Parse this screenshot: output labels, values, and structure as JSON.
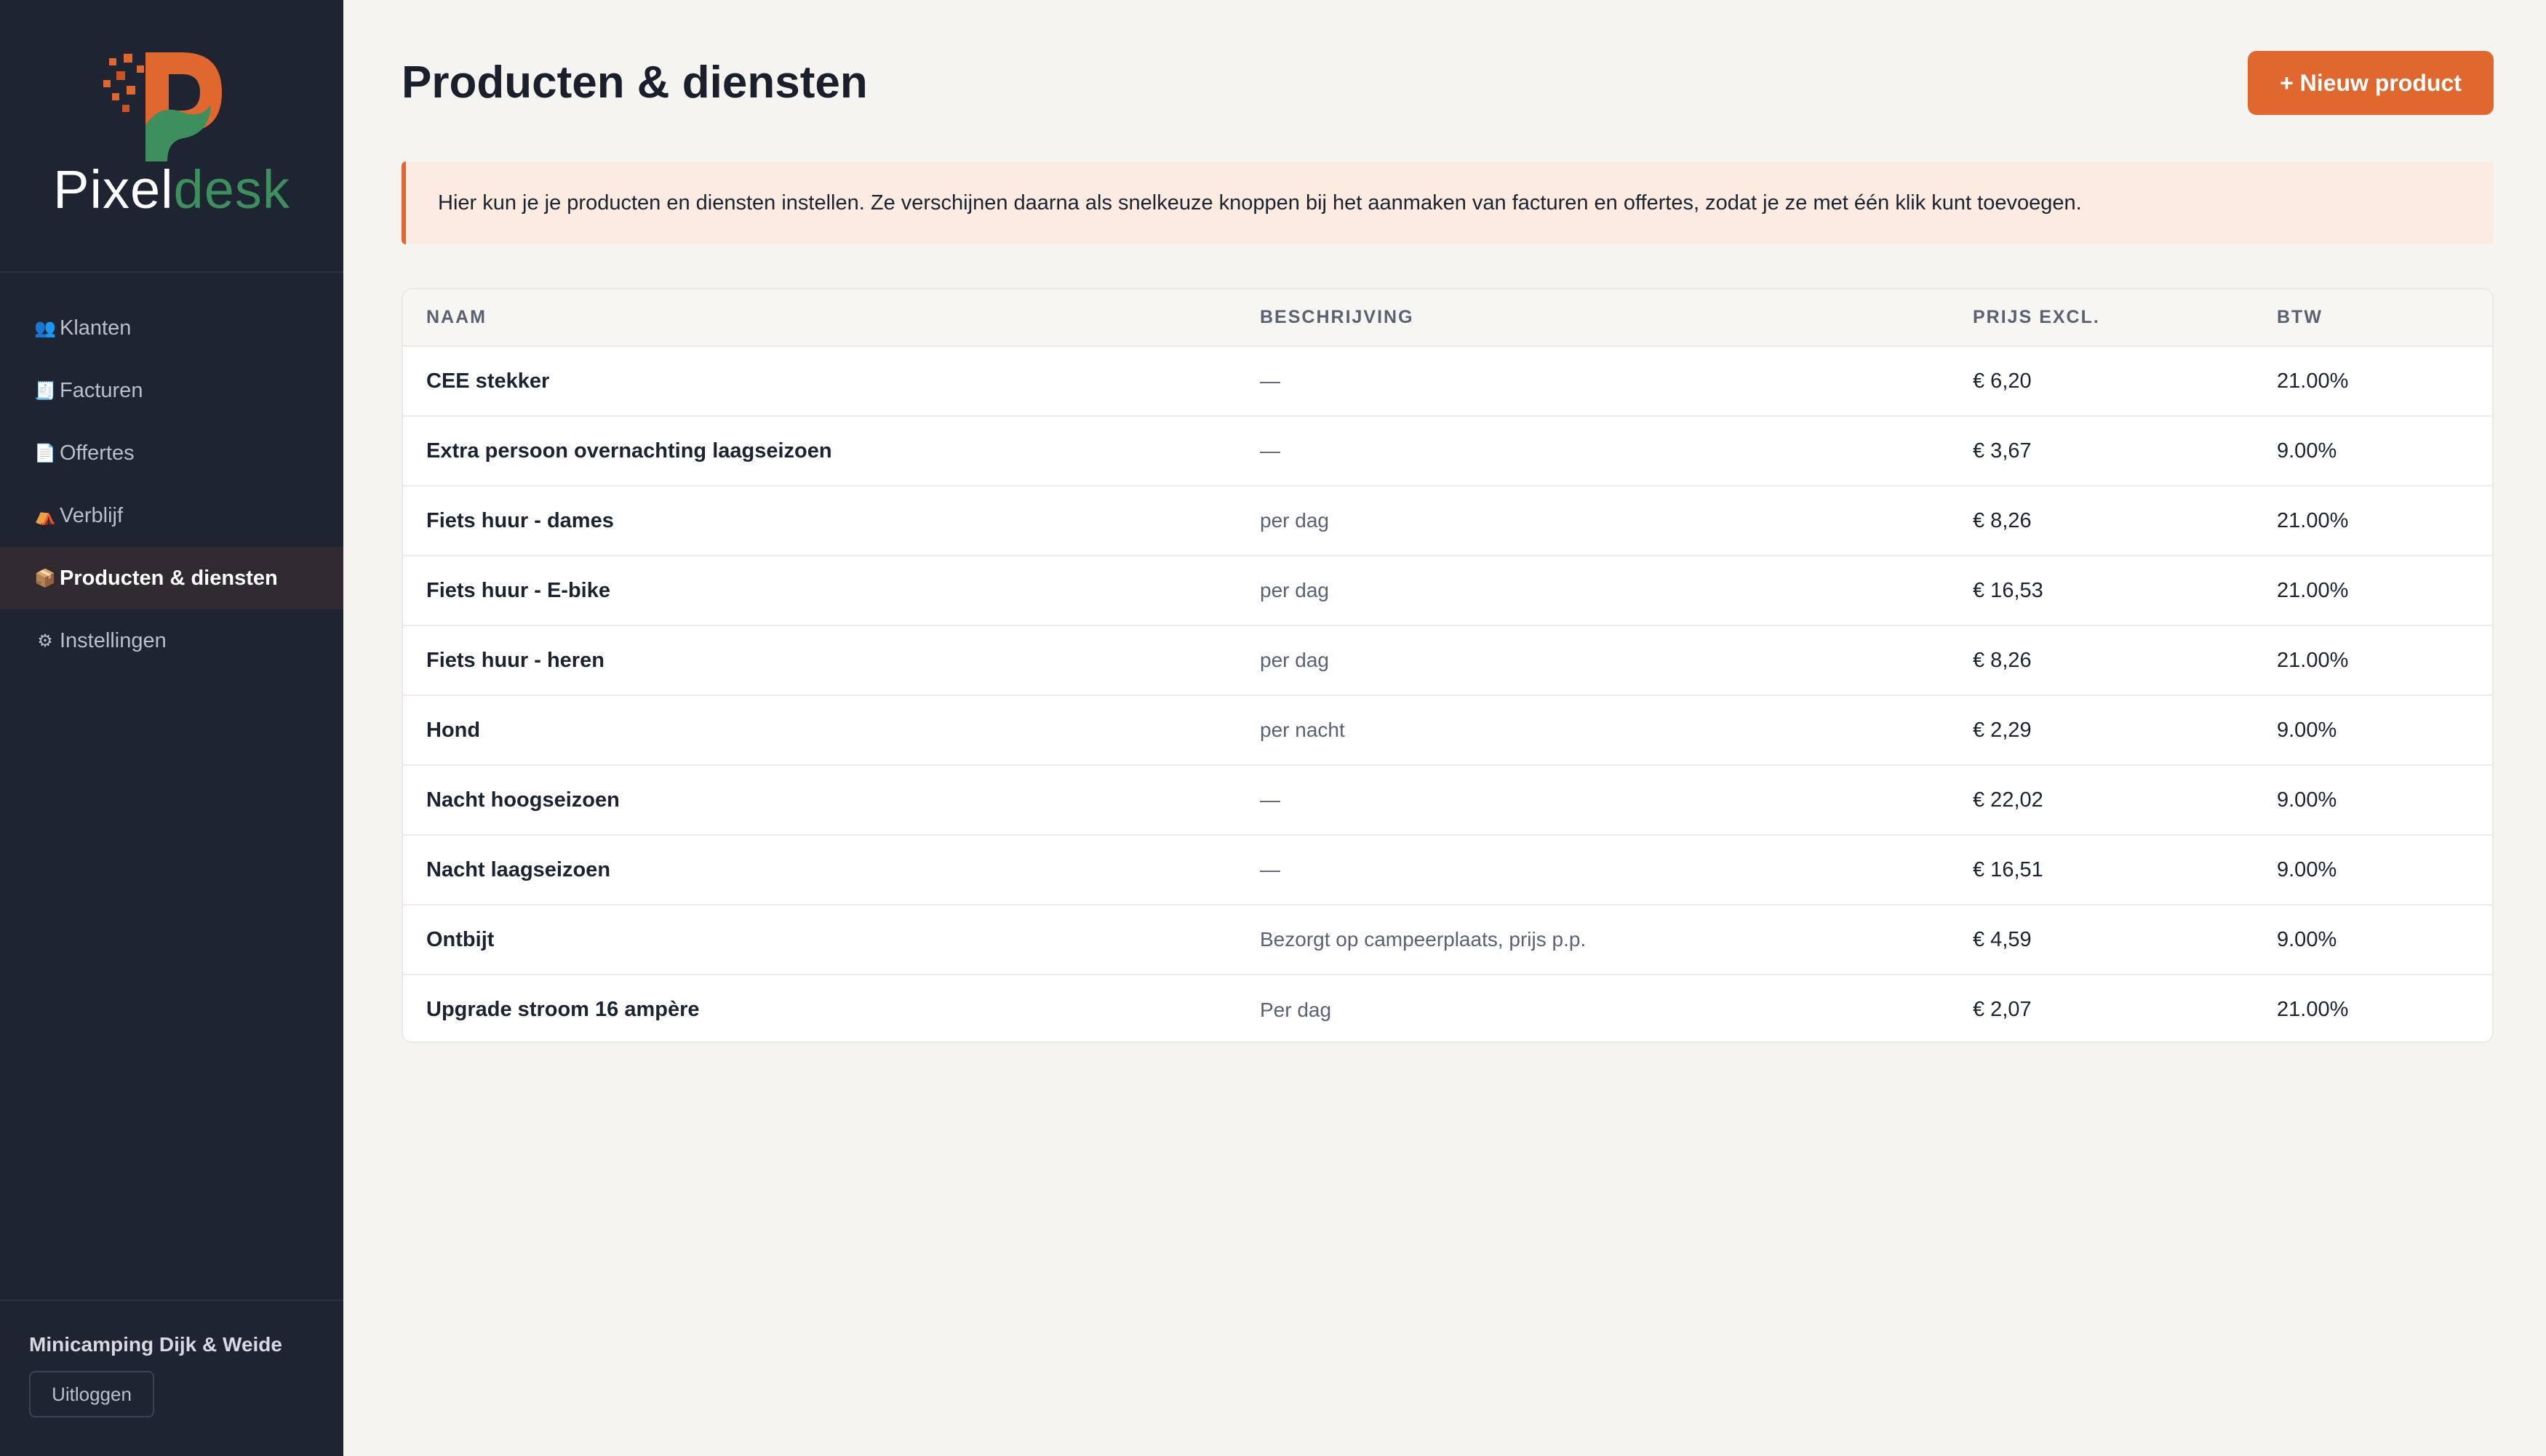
{
  "brand": {
    "word1": "Pixel",
    "word2": "desk",
    "accent": "#e0682e",
    "green": "#3d8f5e"
  },
  "sidebar": {
    "items": [
      {
        "icon": "👥",
        "icon_name": "users-icon",
        "label": "Klanten"
      },
      {
        "icon": "🧾",
        "icon_name": "receipt-icon",
        "label": "Facturen"
      },
      {
        "icon": "📄",
        "icon_name": "document-icon",
        "label": "Offertes"
      },
      {
        "icon": "⛺",
        "icon_name": "tent-icon",
        "label": "Verblijf"
      },
      {
        "icon": "📦",
        "icon_name": "package-icon",
        "label": "Producten & diensten"
      },
      {
        "icon": "⚙",
        "icon_name": "gear-icon",
        "label": "Instellingen"
      }
    ],
    "org_name": "Minicamping Dijk & Weide",
    "logout_label": "Uitloggen"
  },
  "page": {
    "title": "Producten & diensten",
    "new_button": "+ Nieuw product",
    "info": "Hier kun je je producten en diensten instellen. Ze verschijnen daarna als snelkeuze knoppen bij het aanmaken van facturen en offertes, zodat je ze met één klik kunt toevoegen."
  },
  "table": {
    "headers": [
      "Naam",
      "Beschrijving",
      "Prijs excl.",
      "BTW"
    ],
    "rows": [
      {
        "name": "CEE stekker",
        "desc": "—",
        "price": "€ 6,20",
        "vat": "21.00%"
      },
      {
        "name": "Extra persoon overnachting laagseizoen",
        "desc": "—",
        "price": "€ 3,67",
        "vat": "9.00%"
      },
      {
        "name": "Fiets huur - dames",
        "desc": "per dag",
        "price": "€ 8,26",
        "vat": "21.00%"
      },
      {
        "name": "Fiets huur - E-bike",
        "desc": "per dag",
        "price": "€ 16,53",
        "vat": "21.00%"
      },
      {
        "name": "Fiets huur - heren",
        "desc": "per dag",
        "price": "€ 8,26",
        "vat": "21.00%"
      },
      {
        "name": "Hond",
        "desc": "per nacht",
        "price": "€ 2,29",
        "vat": "9.00%"
      },
      {
        "name": "Nacht hoogseizoen",
        "desc": "—",
        "price": "€ 22,02",
        "vat": "9.00%"
      },
      {
        "name": "Nacht laagseizoen",
        "desc": "—",
        "price": "€ 16,51",
        "vat": "9.00%"
      },
      {
        "name": "Ontbijt",
        "desc": "Bezorgt op campeerplaats, prijs p.p.",
        "price": "€ 4,59",
        "vat": "9.00%"
      },
      {
        "name": "Upgrade stroom 16 ampère",
        "desc": "Per dag",
        "price": "€ 2,07",
        "vat": "21.00%"
      }
    ]
  }
}
